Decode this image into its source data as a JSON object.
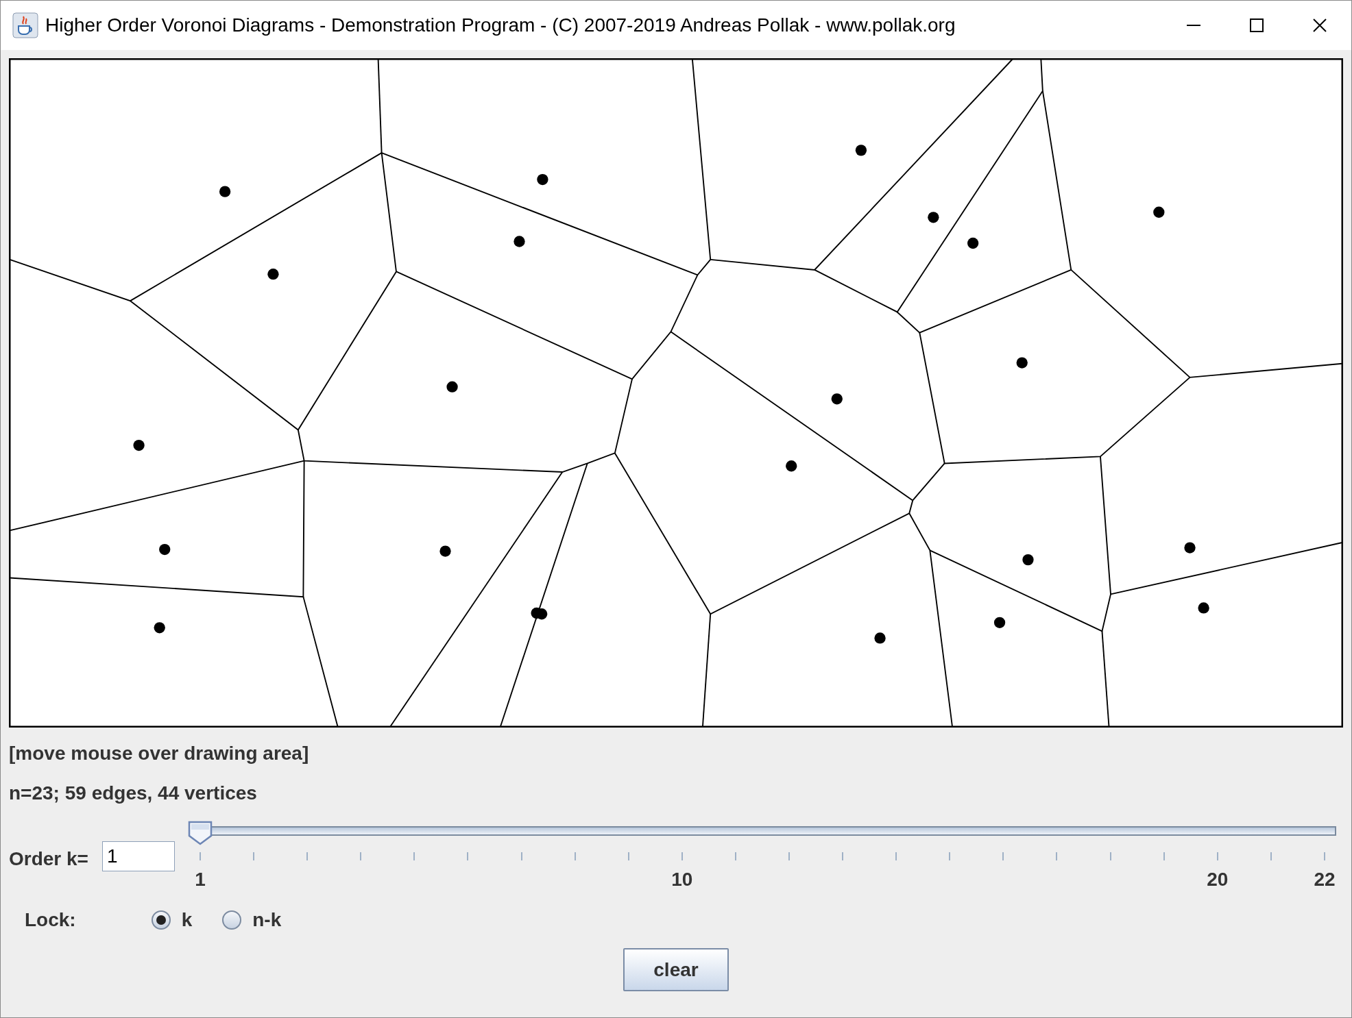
{
  "window": {
    "title": "Higher Order Voronoi Diagrams - Demonstration Program - (C) 2007-2019 Andreas Pollak - www.pollak.org"
  },
  "status_text": "[move mouse over drawing area]",
  "stats_text": "n=23; 59 edges, 44 vertices",
  "order": {
    "label": "Order k=",
    "value": "1",
    "slider": {
      "level": 0,
      "tick_labels": [
        "1",
        "10",
        "20",
        "22"
      ]
    }
  },
  "lock": {
    "label": "Lock:",
    "options": [
      {
        "label": "k",
        "selected": true
      },
      {
        "label": "n-k",
        "selected": false
      }
    ]
  },
  "buttons": [
    "clear"
  ]
}
